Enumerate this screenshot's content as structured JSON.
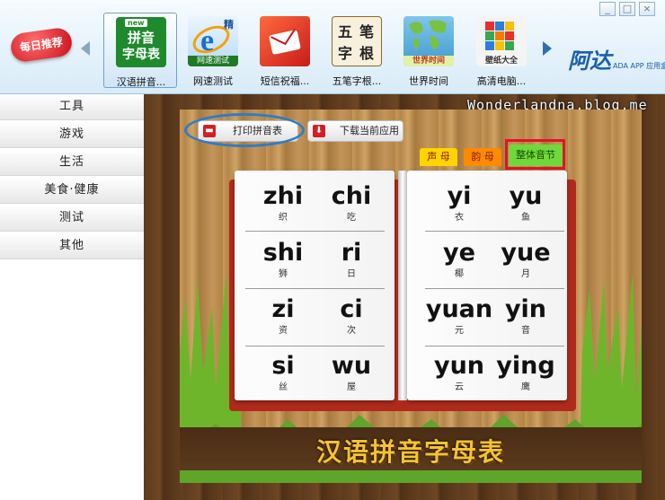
{
  "window_controls": [
    "_",
    "□",
    "×"
  ],
  "toolbar": {
    "badge": "每日推荐",
    "apps": [
      {
        "label": "汉语拼音...",
        "icon_new": "new",
        "icon_text": [
          "拼音",
          "字母表"
        ],
        "selected": true,
        "icon": "pinyin-icon"
      },
      {
        "label": "网速测试",
        "icon_text": [
          "网速测试"
        ],
        "corner": "精",
        "icon": "ie-icon"
      },
      {
        "label": "短信祝福...",
        "icon_text": [],
        "icon": "sms-icon"
      },
      {
        "label": "五笔字根...",
        "icon_text": [
          "五",
          "笔",
          "字",
          "根"
        ],
        "icon": "wubi-icon"
      },
      {
        "label": "世界时间",
        "icon_text": [
          "世界时间"
        ],
        "icon": "world-map-icon"
      },
      {
        "label": "高清电脑...",
        "icon_text": [
          "壁纸大全"
        ],
        "icon": "cube-icon"
      }
    ],
    "logo_main": "阿达",
    "logo_sub": "ADA APP 应用盒子"
  },
  "watermark": "Wonderlandna.blog.me",
  "sidebar": {
    "items": [
      {
        "label": "工具"
      },
      {
        "label": "游戏"
      },
      {
        "label": "生活"
      },
      {
        "label": "美食·健康"
      },
      {
        "label": "测试"
      },
      {
        "label": "其他"
      }
    ]
  },
  "actions": {
    "print_label": "打印拼音表",
    "download_label": "下载当前应用"
  },
  "tabs": [
    {
      "label": "声 母",
      "color": "#ffd400"
    },
    {
      "label": "韵 母",
      "color": "#ff8a00"
    },
    {
      "label": "整体音节",
      "color": "#6fd93a",
      "active": true
    }
  ],
  "syllables": {
    "left": [
      {
        "py": "zhi",
        "hz": "织"
      },
      {
        "py": "chi",
        "hz": "吃"
      },
      {
        "py": "shi",
        "hz": "狮"
      },
      {
        "py": "ri",
        "hz": "日"
      },
      {
        "py": "zi",
        "hz": "资"
      },
      {
        "py": "ci",
        "hz": "次"
      },
      {
        "py": "si",
        "hz": "丝"
      },
      {
        "py": "wu",
        "hz": "屋"
      }
    ],
    "right": [
      {
        "py": "yi",
        "hz": "衣"
      },
      {
        "py": "yu",
        "hz": "鱼"
      },
      {
        "py": "ye",
        "hz": "椰"
      },
      {
        "py": "yue",
        "hz": "月"
      },
      {
        "py": "yuan",
        "hz": "元"
      },
      {
        "py": "yin",
        "hz": "音"
      },
      {
        "py": "yun",
        "hz": "云"
      },
      {
        "py": "ying",
        "hz": "鹰"
      }
    ]
  },
  "banner_title": "汉语拼音字母表",
  "colors": {
    "accent_blue": "#2e7cc6",
    "highlight_red": "#e0142a",
    "title_gold": "#f5c232"
  }
}
